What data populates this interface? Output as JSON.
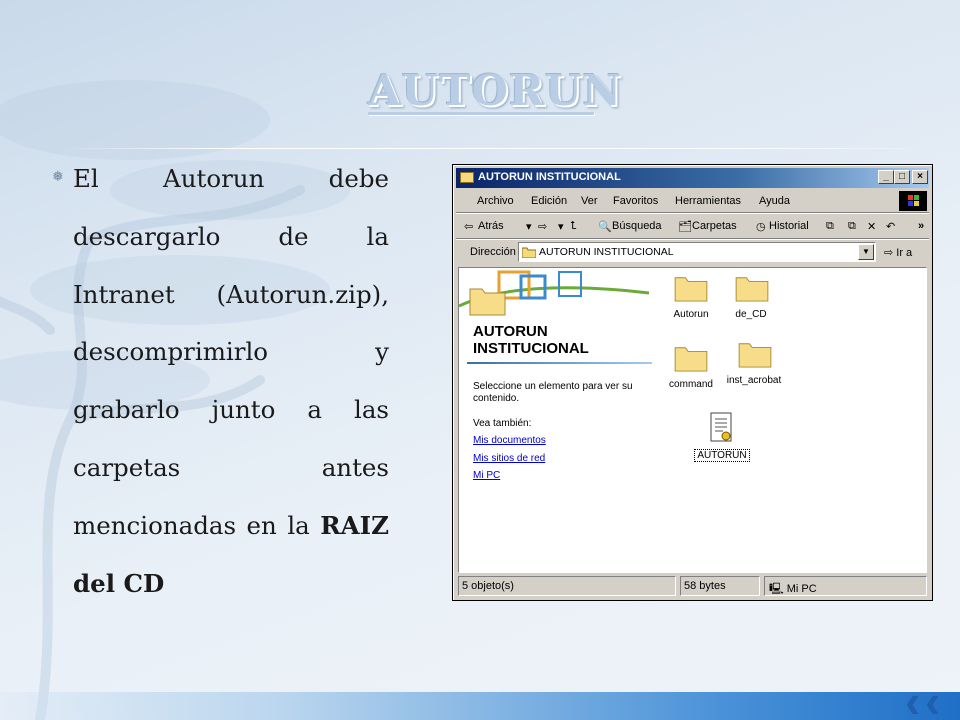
{
  "slide": {
    "title": "AUTORUN",
    "bullet_text": "El Autorun debe descargarlo de la Intranet (Autorun.zip), descomprimirlo y grabarlo junto a las carpetas antes mencionadas en la",
    "bullet_bold": "RAIZ del CD"
  },
  "window": {
    "title": "AUTORUN INSTITUCIONAL",
    "menu": [
      "Archivo",
      "Edición",
      "Ver",
      "Favoritos",
      "Herramientas",
      "Ayuda"
    ],
    "toolbar": {
      "back": "Atrás",
      "search": "Búsqueda",
      "folders": "Carpetas",
      "history": "Historial",
      "more": "»"
    },
    "address": {
      "label": "Dirección",
      "value": "AUTORUN INSTITUCIONAL",
      "go": "Ir a"
    },
    "panel": {
      "heading_line1": "AUTORUN",
      "heading_line2": "INSTITUCIONAL",
      "prompt": "Seleccione un elemento para ver su contenido.",
      "see_also": "Vea también:",
      "links": [
        "Mis documentos",
        "Mis sitios de red",
        "Mi PC"
      ]
    },
    "items": [
      "Autorun",
      "de_CD",
      "command",
      "inst_acrobat",
      "AUTORUN"
    ],
    "status": {
      "objects": "5 objeto(s)",
      "size": "58 bytes",
      "location": "Mi PC"
    }
  }
}
